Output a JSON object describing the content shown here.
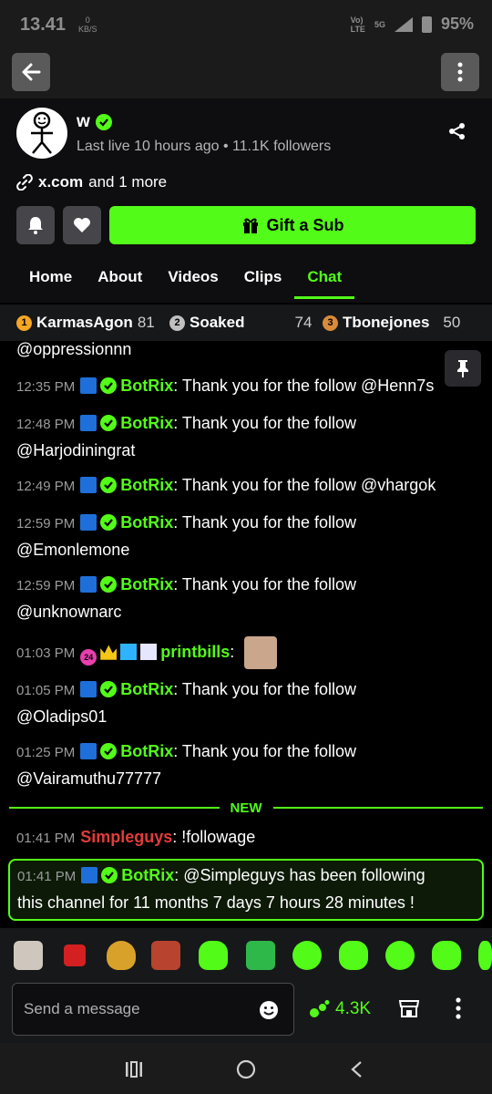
{
  "status": {
    "time": "13.41",
    "kbs_top": "0",
    "kbs_bottom": "KB/S",
    "net_top": "Vo)",
    "net_bottom": "LTE",
    "network": "5G",
    "battery": "95%"
  },
  "channel": {
    "name": "w",
    "meta": "Last live 10 hours ago • 11.1K followers",
    "link_main": "x.com",
    "link_more": "and 1 more",
    "gift_label": "Gift a Sub",
    "tabs": [
      "Home",
      "About",
      "Videos",
      "Clips",
      "Chat"
    ]
  },
  "leaderboard": [
    {
      "rank": "1",
      "name": "KarmasAgon",
      "score": "81",
      "color": "#f5a623"
    },
    {
      "rank": "2",
      "name": "Soaked",
      "score": "74",
      "color": "#c0c0c0"
    },
    {
      "rank": "3",
      "name": "Tbonejones",
      "score": "50",
      "color": "#d98b3a"
    }
  ],
  "chat": {
    "partial_top": "@oppressionnn",
    "messages": [
      {
        "time": "12:35 PM",
        "user": "BotRix",
        "text": "Thank you for the follow @Henn7s"
      },
      {
        "time": "12:48 PM",
        "user": "BotRix",
        "text": "Thank you for the follow",
        "text2": "@Harjodiningrat"
      },
      {
        "time": "12:49 PM",
        "user": "BotRix",
        "text": "Thank you for the follow @vhargok"
      },
      {
        "time": "12:59 PM",
        "user": "BotRix",
        "text": "Thank you for the follow",
        "text2": "@Emonlemone"
      },
      {
        "time": "12:59 PM",
        "user": "BotRix",
        "text": "Thank you for the follow",
        "text2": "@unknownarc"
      },
      {
        "time": "01:03 PM",
        "user": "printbills",
        "badge_num": "24"
      },
      {
        "time": "01:05 PM",
        "user": "BotRix",
        "text": "Thank you for the follow",
        "text2": "@Oladips01"
      },
      {
        "time": "01:25 PM",
        "user": "BotRix",
        "text": "Thank you for the follow",
        "text2": "@Vairamuthu77777"
      }
    ],
    "new_label": "NEW",
    "after_new": [
      {
        "time": "01:41 PM",
        "user": "Simpleguys",
        "text": "!followage"
      },
      {
        "time": "01:41 PM",
        "user": "BotRix",
        "text": "@Simpleguys has been following",
        "text2": "this channel for 11 months 7 days 7 hours 28 minutes !"
      }
    ]
  },
  "input": {
    "placeholder": "Send a message",
    "kicks": "4.3K"
  },
  "colors": {
    "accent": "#53fc18",
    "danger": "#e23b3b",
    "background": "#000000"
  }
}
